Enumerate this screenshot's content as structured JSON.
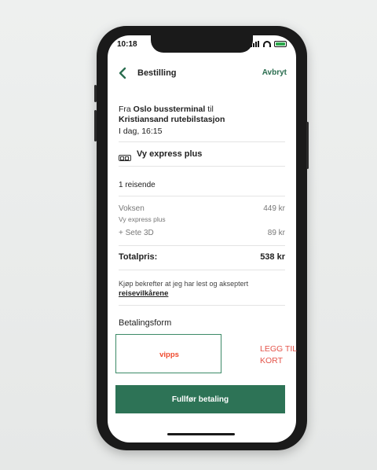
{
  "status": {
    "time": "10:18"
  },
  "header": {
    "title": "Bestilling",
    "cancel_label": "Avbryt"
  },
  "trip": {
    "from_prefix": "Fra",
    "from": "Oslo bussterminal",
    "to_prefix": "til",
    "to": "Kristiansand rutebilstasjon",
    "date": "I dag, 16:15",
    "operator": "Vy express plus"
  },
  "travelers": {
    "count_label": "1 reisende"
  },
  "lines": [
    {
      "label": "Voksen",
      "sublabel": "Vy express plus",
      "price": "449 kr"
    },
    {
      "label": "+ Sete 3D",
      "price": "89 kr"
    }
  ],
  "total": {
    "label": "Totalpris:",
    "value": "538 kr"
  },
  "terms": {
    "text": "Kjøp bekrefter at jeg har lest og akseptert",
    "link": "reisevilkårene"
  },
  "payment": {
    "section_title": "Betalingsform",
    "vipps_label": "vipps",
    "add_card_line1": "LEGG TIL",
    "add_card_line2": "KORT"
  },
  "pay_button_label": "Fullfør betaling",
  "colors": {
    "brand_green": "#2d7356",
    "vipps_orange": "#ef4a2e",
    "add_card_red": "#e4544a"
  }
}
